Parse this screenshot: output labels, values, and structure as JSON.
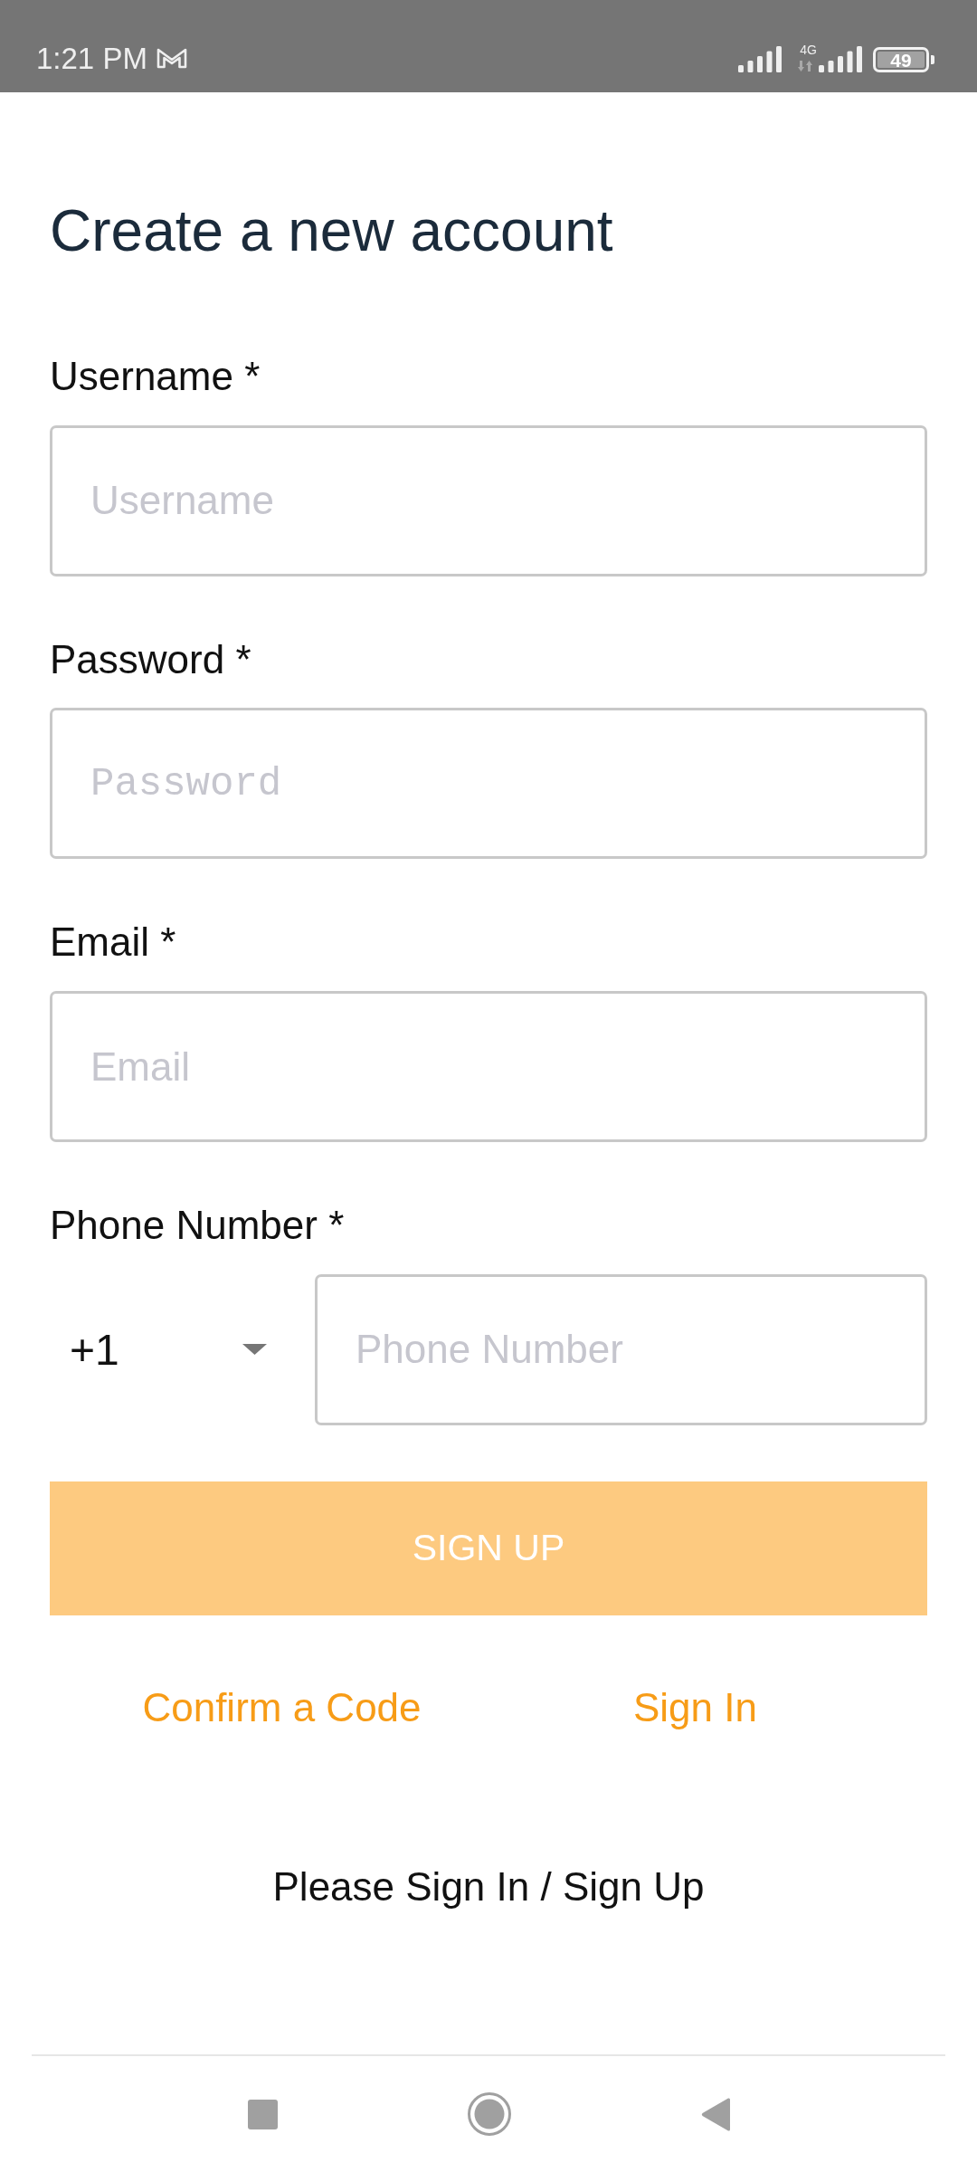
{
  "status_bar": {
    "time": "1:21 PM",
    "network_type": "4G",
    "battery": "49"
  },
  "form": {
    "title": "Create a new account",
    "fields": [
      {
        "kind": "text",
        "label": "Username *",
        "placeholder": "Username"
      },
      {
        "kind": "password",
        "label": "Password *",
        "placeholder": "Password"
      },
      {
        "kind": "email",
        "label": "Email *",
        "placeholder": "Email"
      },
      {
        "kind": "phone",
        "label": "Phone Number *",
        "country_code": "+1",
        "placeholder": "Phone Number"
      }
    ],
    "submit_button": {
      "label": "SIGN UP",
      "disabled": true
    },
    "links": [
      "Confirm a Code",
      "Sign In"
    ]
  },
  "footer_message": "Please Sign In / Sign Up"
}
